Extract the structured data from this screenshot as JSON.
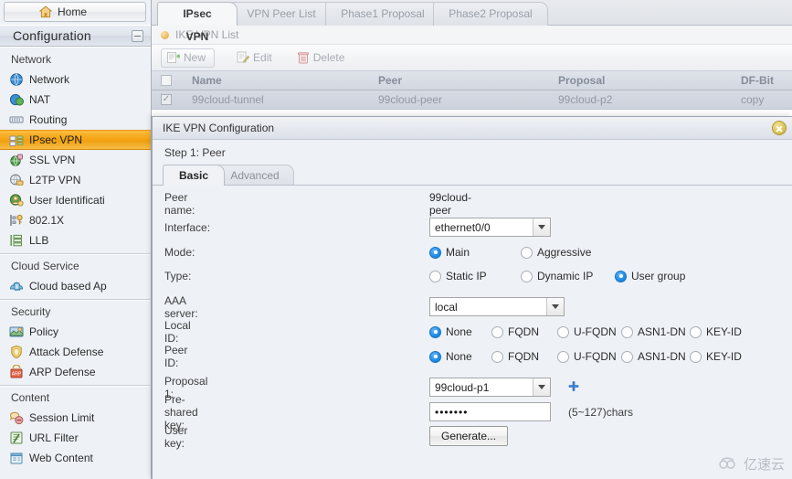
{
  "sidebar": {
    "home_label": "Home",
    "config_label": "Configuration",
    "groups": [
      {
        "title": "Network",
        "items": [
          {
            "label": "Network",
            "icon": "globe-icon",
            "selected": false
          },
          {
            "label": "NAT",
            "icon": "nat-icon",
            "selected": false
          },
          {
            "label": "Routing",
            "icon": "routing-icon",
            "selected": false
          },
          {
            "label": "IPsec VPN",
            "icon": "ipsec-vpn-icon",
            "selected": true
          },
          {
            "label": "SSL VPN",
            "icon": "ssl-vpn-icon",
            "selected": false
          },
          {
            "label": "L2TP VPN",
            "icon": "l2tp-vpn-icon",
            "selected": false
          },
          {
            "label": "User Identificati",
            "icon": "user-id-icon",
            "selected": false
          },
          {
            "label": "802.1X",
            "icon": "dot1x-icon",
            "selected": false
          },
          {
            "label": "LLB",
            "icon": "llb-icon",
            "selected": false
          }
        ]
      },
      {
        "title": "Cloud Service",
        "items": [
          {
            "label": "Cloud based Ap",
            "icon": "cloud-icon",
            "selected": false
          }
        ]
      },
      {
        "title": "Security",
        "items": [
          {
            "label": "Policy",
            "icon": "policy-icon",
            "selected": false
          },
          {
            "label": "Attack Defense",
            "icon": "shield-icon",
            "selected": false
          },
          {
            "label": "ARP Defense",
            "icon": "arp-defense-icon",
            "selected": false
          }
        ]
      },
      {
        "title": "Content",
        "items": [
          {
            "label": "Session Limit",
            "icon": "session-limit-icon",
            "selected": false
          },
          {
            "label": "URL Filter",
            "icon": "url-filter-icon",
            "selected": false
          },
          {
            "label": "Web Content",
            "icon": "web-content-icon",
            "selected": false
          }
        ]
      }
    ]
  },
  "tabs": [
    {
      "label": "IPsec VPN",
      "active": true
    },
    {
      "label": "VPN Peer List",
      "active": false
    },
    {
      "label": "Phase1 Proposal",
      "active": false
    },
    {
      "label": "Phase2 Proposal",
      "active": false
    }
  ],
  "breadcrumb": "IKE VPN List",
  "toolbar": {
    "new_label": "New",
    "edit_label": "Edit",
    "delete_label": "Delete"
  },
  "table": {
    "columns": [
      "Name",
      "Peer",
      "Proposal",
      "DF-Bit"
    ],
    "rows": [
      {
        "checked": true,
        "name": "99cloud-tunnel",
        "peer": "99cloud-peer",
        "proposal": "99cloud-p2",
        "df_bit": "copy"
      }
    ]
  },
  "dialog": {
    "title": "IKE VPN Configuration",
    "step": "Step 1: Peer",
    "tabs": [
      {
        "label": "Basic",
        "active": true
      },
      {
        "label": "Advanced",
        "active": false
      }
    ],
    "fields": {
      "peer_name_label": "Peer name:",
      "peer_name_value": "99cloud-peer",
      "interface_label": "Interface:",
      "interface_value": "ethernet0/0",
      "mode_label": "Mode:",
      "mode_options": [
        {
          "label": "Main",
          "selected": true
        },
        {
          "label": "Aggressive",
          "selected": false
        }
      ],
      "type_label": "Type:",
      "type_options": [
        {
          "label": "Static IP",
          "selected": false
        },
        {
          "label": "Dynamic IP",
          "selected": false
        },
        {
          "label": "User group",
          "selected": true
        }
      ],
      "aaa_label": "AAA server:",
      "aaa_value": "local",
      "local_id_label": "Local ID:",
      "local_id_options": [
        {
          "label": "None",
          "selected": true
        },
        {
          "label": "FQDN",
          "selected": false
        },
        {
          "label": "U-FQDN",
          "selected": false
        },
        {
          "label": "ASN1-DN",
          "selected": false
        },
        {
          "label": "KEY-ID",
          "selected": false
        }
      ],
      "peer_id_label": "Peer ID:",
      "peer_id_options": [
        {
          "label": "None",
          "selected": true
        },
        {
          "label": "FQDN",
          "selected": false
        },
        {
          "label": "U-FQDN",
          "selected": false
        },
        {
          "label": "ASN1-DN",
          "selected": false
        },
        {
          "label": "KEY-ID",
          "selected": false
        }
      ],
      "proposal1_label": "Proposal 1:",
      "proposal1_value": "99cloud-p1",
      "psk_label": "Pre-shared key:",
      "psk_value": "•••••••",
      "psk_hint": "(5~127)chars",
      "userkey_label": "User key:",
      "generate_label": "Generate..."
    }
  },
  "watermark": "亿速云",
  "colors": {
    "accent_orange": "#f5a416",
    "radio_blue": "#1f8fe8",
    "sidebar_bg": "#eef1f6",
    "dialog_bg": "#eef1f6"
  }
}
